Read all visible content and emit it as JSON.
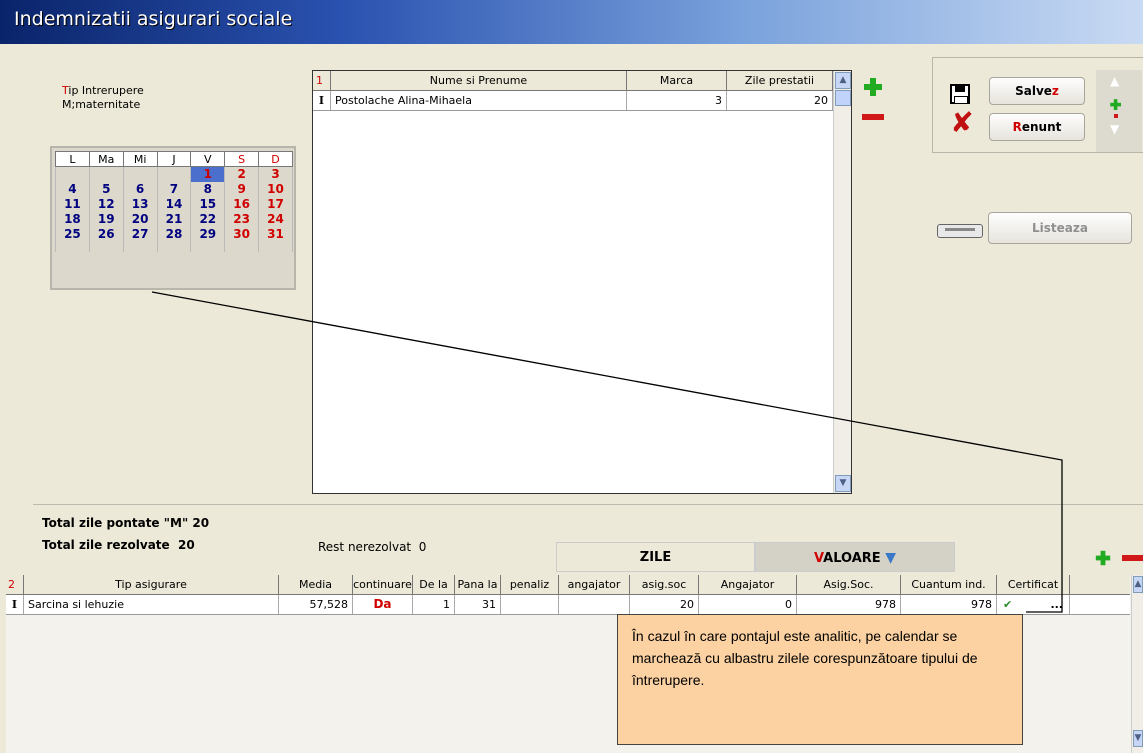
{
  "window": {
    "title": "Indemnizatii asigurari sociale"
  },
  "interruption": {
    "label": "Tip Intrerupere",
    "value": "M;maternitate"
  },
  "calendar": {
    "weekdays": [
      "L",
      "Ma",
      "Mi",
      "J",
      "V",
      "S",
      "D"
    ],
    "weeks": [
      [
        "",
        "",
        "",
        "",
        "1",
        "2",
        "3"
      ],
      [
        "4",
        "5",
        "6",
        "7",
        "8",
        "9",
        "10"
      ],
      [
        "11",
        "12",
        "13",
        "14",
        "15",
        "16",
        "17"
      ],
      [
        "18",
        "19",
        "20",
        "21",
        "22",
        "23",
        "24"
      ],
      [
        "25",
        "26",
        "27",
        "28",
        "29",
        "30",
        "31"
      ]
    ],
    "selected_day": "1",
    "day_color": "#000080",
    "weekend_color": "#d00000",
    "selected_color": "#4a6fcc"
  },
  "employee_grid": {
    "index_label": "1",
    "columns": [
      "Nume si Prenume",
      "Marca",
      "Zile prestatii"
    ],
    "rows": [
      {
        "marker": "I",
        "name": "Postolache Alina-Mihaela",
        "marca": "3",
        "zile": "20"
      }
    ]
  },
  "buttons": {
    "save": {
      "hotkey": "Salve",
      "tail": "z"
    },
    "cancel": {
      "hotkey": "R",
      "tail": "enunt"
    },
    "list": "Listeaza"
  },
  "totals": {
    "pontate_label": "Total zile pontate \"M\"",
    "pontate_value": "20",
    "rezolvate_label": "Total zile rezolvate",
    "rezolvate_value": "20",
    "rest_label": "Rest nerezolvat",
    "rest_value": "0"
  },
  "sections": {
    "zile": "ZILE",
    "valoare_first": "V",
    "valoare_rest": "ALOARE"
  },
  "insurance_grid": {
    "index_label": "2",
    "columns": [
      "Tip asigurare",
      "Media",
      "continuare",
      "De la",
      "Pana la",
      "penaliz",
      "angajator",
      "asig.soc",
      "Angajator",
      "Asig.Soc.",
      "Cuantum ind.",
      "Certificat"
    ],
    "rows": [
      {
        "marker": "I",
        "tip": "Sarcina si lehuzie",
        "media": "57,528",
        "continuare": "Da",
        "de_la": "1",
        "pana_la": "31",
        "penaliz": "",
        "angajator_zile": "",
        "asig_soc_zile": "20",
        "angajator_val": "0",
        "asig_soc_val": "978",
        "cuantum": "978",
        "certificat_check": "✔",
        "certificat_more": "..."
      }
    ]
  },
  "tooltip": {
    "text": "În cazul în care pontajul este analitic, pe calendar se marchează cu albastru zilele corespunzătoare tipului de întrerupere."
  },
  "colors": {
    "accent_red": "#d00000",
    "add_green": "#22aa22",
    "tooltip_bg": "#fcd2a2"
  }
}
